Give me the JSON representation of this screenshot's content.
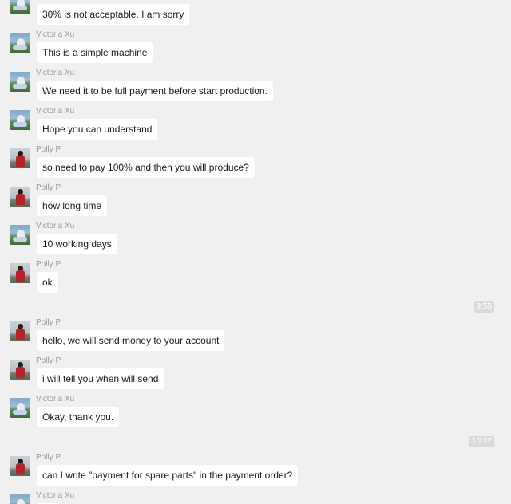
{
  "messages": [
    {
      "sender": "",
      "avatar": "victoria-avatar",
      "text": "30% is not acceptable. I am sorry"
    },
    {
      "sender": "Victoria Xu",
      "avatar": "victoria-avatar",
      "text": "This is a simple machine"
    },
    {
      "sender": "Victoria Xu",
      "avatar": "victoria-avatar",
      "text": "We need it to be full payment before start production."
    },
    {
      "sender": "Victoria Xu",
      "avatar": "victoria-avatar",
      "text": "Hope you can understand"
    },
    {
      "sender": "Polly P",
      "avatar": "polly-avatar",
      "text": "so need to pay 100% and then you will produce?"
    },
    {
      "sender": "Polly P",
      "avatar": "polly-avatar",
      "text": "how long time"
    },
    {
      "sender": "Victoria Xu",
      "avatar": "victoria-avatar",
      "text": "10 working days"
    },
    {
      "sender": "Polly P",
      "avatar": "polly-avatar",
      "text": "ok"
    },
    {
      "sender": "Polly P",
      "avatar": "polly-avatar",
      "text": "hello, we will send money to your account"
    },
    {
      "sender": "Polly P",
      "avatar": "polly-avatar",
      "text": "i will tell you when will send"
    },
    {
      "sender": "Victoria Xu",
      "avatar": "victoria-avatar",
      "text": "Okay, thank you."
    },
    {
      "sender": "Polly P",
      "avatar": "polly-avatar",
      "text": "can I write \"payment for spare parts\" in the payment order?"
    },
    {
      "sender": "Victoria Xu",
      "avatar": "victoria-avatar",
      "text": ""
    }
  ],
  "timestamps": [
    "9:55",
    "10:27"
  ]
}
